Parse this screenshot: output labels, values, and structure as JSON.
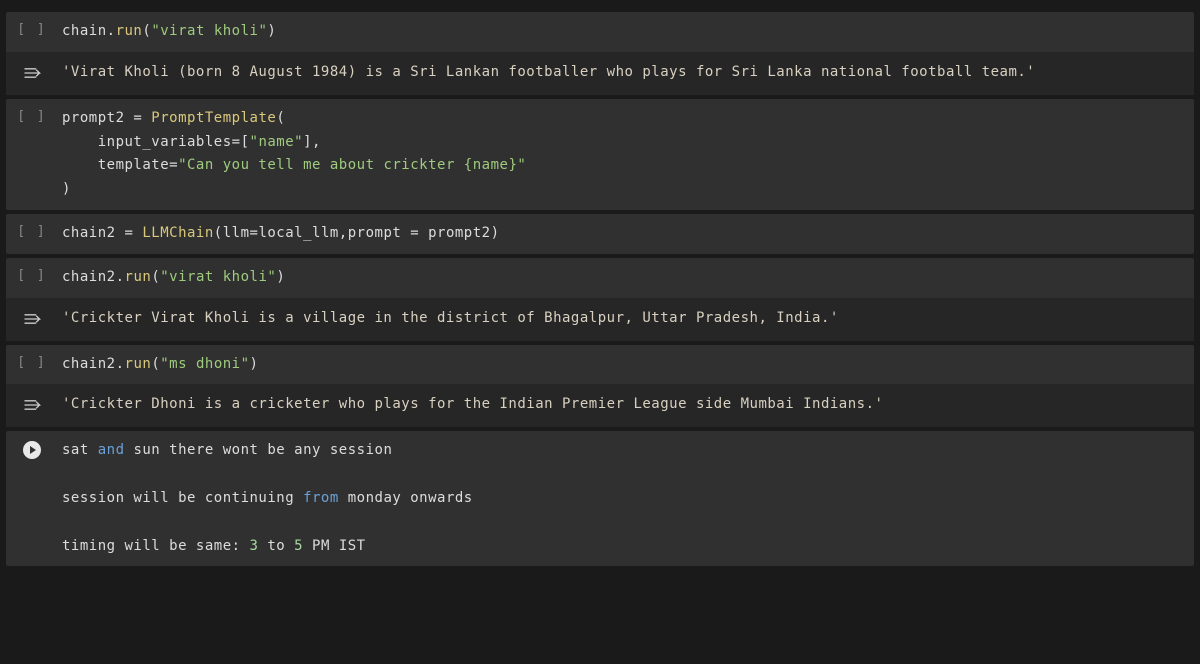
{
  "cells": {
    "c1_code": "chain.run(\"virat kholi\")",
    "c1_out": "'Virat Kholi (born 8 August 1984) is a Sri Lankan footballer who plays for Sri Lanka national football team.'",
    "c2_line1_a": "prompt2 = ",
    "c2_line1_b": "PromptTemplate",
    "c2_line1_c": "(",
    "c2_line2_a": "    input_variables=[",
    "c2_line2_b": "\"name\"",
    "c2_line2_c": "],",
    "c2_line3_a": "    template=",
    "c2_line3_b": "\"Can you tell me about crickter {name}\"",
    "c2_line4": ")",
    "c3_a": "chain2 = ",
    "c3_b": "LLMChain",
    "c3_c": "(llm=local_llm,prompt = prompt2)",
    "c4_code": "chain2.run(\"virat kholi\")",
    "c4_out": "'Crickter Virat Kholi is a village in the district of Bhagalpur, Uttar Pradesh, India.'",
    "c5_code": "chain2.run(\"ms dhoni\")",
    "c5_out": "'Crickter Dhoni is a cricketer who plays for the Indian Premier League side Mumbai Indians.'",
    "c6_l1_a": "sat ",
    "c6_l1_b": "and",
    "c6_l1_c": " sun there wont be any session",
    "c6_l2_a": "session will be continuing ",
    "c6_l2_b": "from",
    "c6_l2_c": " monday onwards",
    "c6_l3_a": "timing will be same: ",
    "c6_l3_b": "3",
    "c6_l3_c": " to ",
    "c6_l3_d": "5",
    "c6_l3_e": " PM IST"
  },
  "chain_run_prefix": "chain.",
  "chain2_run_prefix": "chain2.",
  "run_name": "run",
  "str_virat": "\"virat kholi\"",
  "str_dhoni": "\"ms dhoni\"",
  "paren_open": "(",
  "paren_close": ")"
}
